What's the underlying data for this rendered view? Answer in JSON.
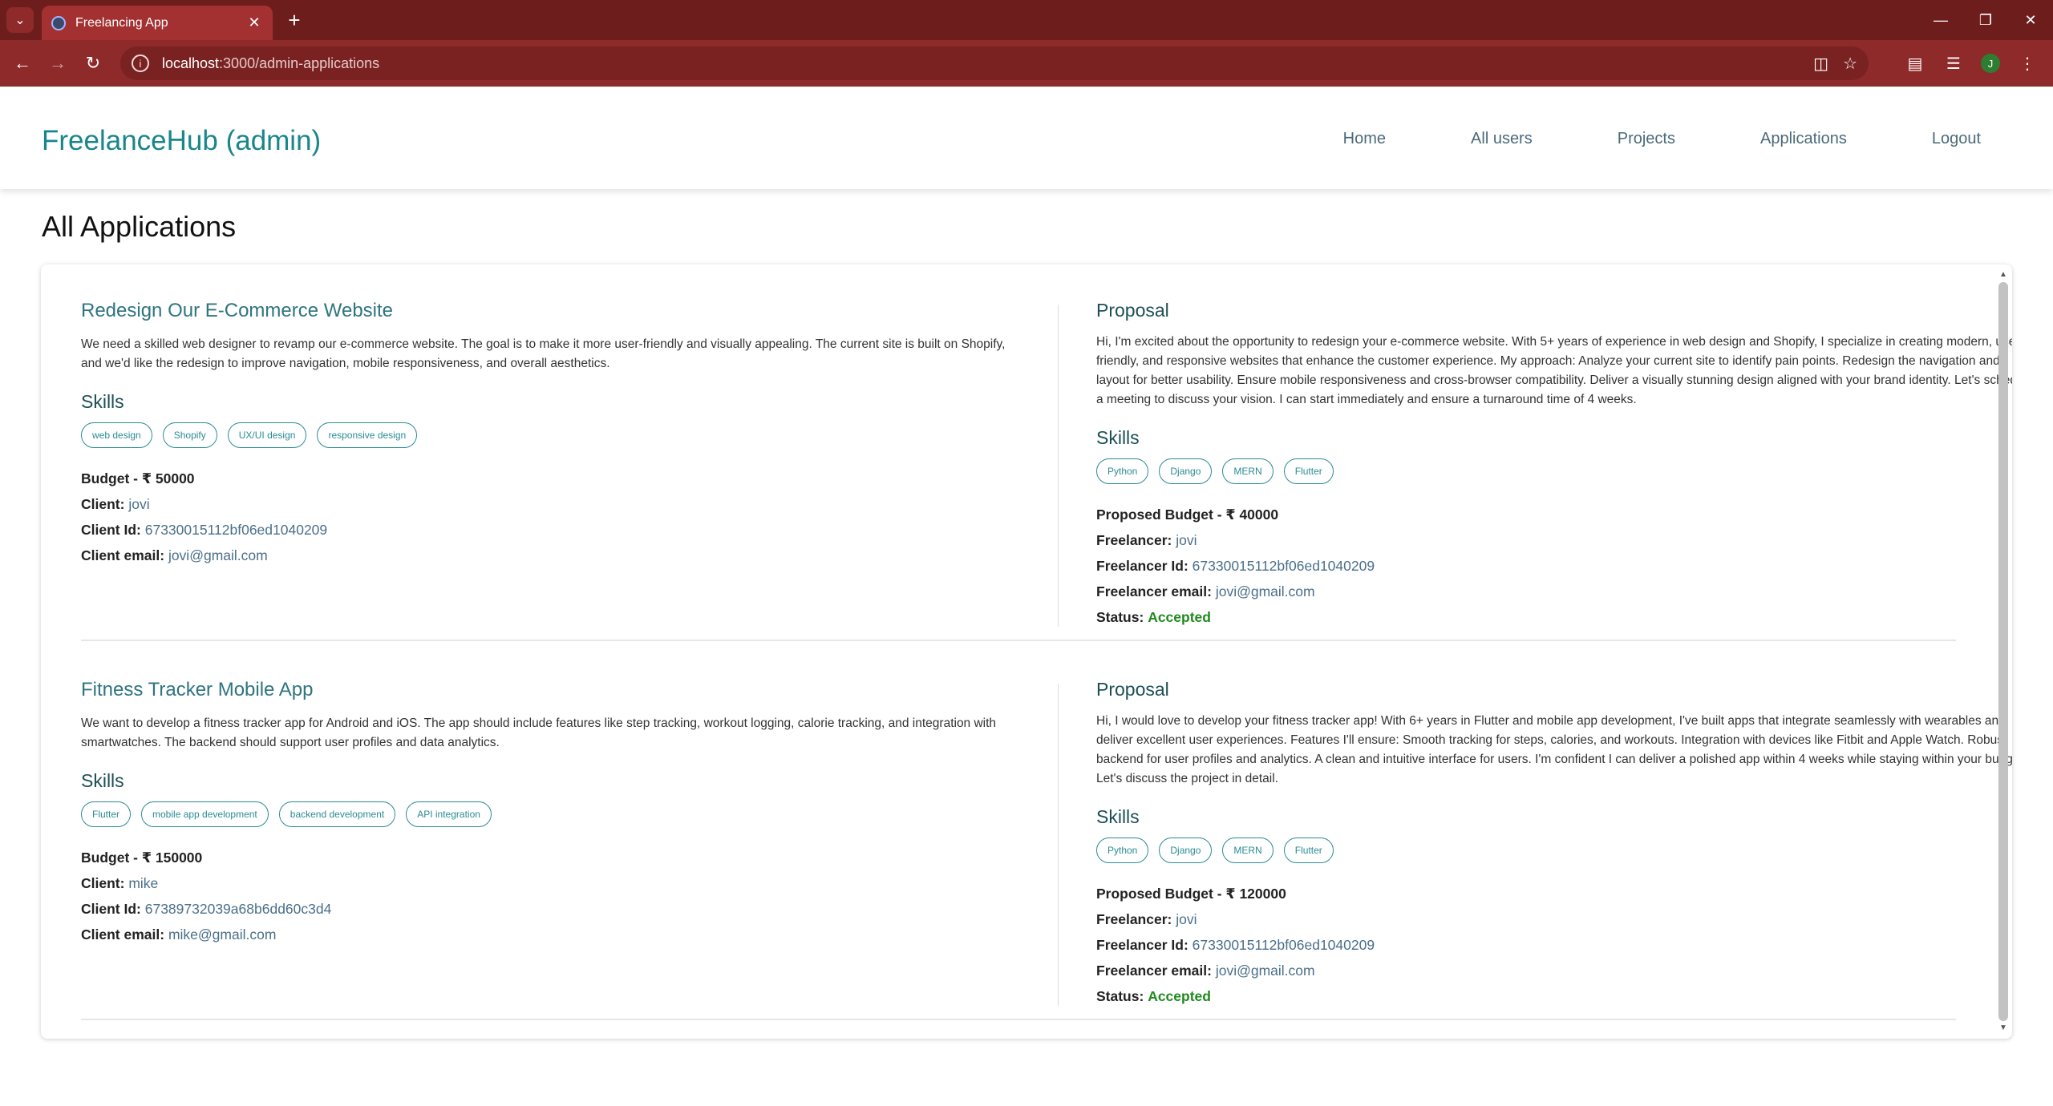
{
  "browser": {
    "tab_title": "Freelancing App",
    "url_host": "localhost",
    "url_path": ":3000/admin-applications",
    "profile_initial": "J"
  },
  "navbar": {
    "brand": "FreelanceHub (admin)",
    "links": [
      "Home",
      "All users",
      "Projects",
      "Applications",
      "Logout"
    ]
  },
  "page_title": "All Applications",
  "labels": {
    "skills": "Skills",
    "proposal": "Proposal",
    "budget": "Budget - ₹",
    "client": "Client:",
    "client_id": "Client Id:",
    "client_email": "Client email:",
    "proposed_budget": "Proposed Budget - ₹",
    "freelancer": "Freelancer:",
    "freelancer_id": "Freelancer Id:",
    "freelancer_email": "Freelancer email:",
    "status": "Status:"
  },
  "applications": [
    {
      "title": "Redesign Our E-Commerce Website",
      "description": "We need a skilled web designer to revamp our e-commerce website. The goal is to make it more user-friendly and visually appealing. The current site is built on Shopify, and we'd like the redesign to improve navigation, mobile responsiveness, and overall aesthetics.",
      "skills": [
        "web design",
        "Shopify",
        "UX/UI design",
        "responsive design"
      ],
      "budget": "50000",
      "client": "jovi",
      "client_id": "67330015112bf06ed1040209",
      "client_email": "jovi@gmail.com",
      "proposal": "Hi, I'm excited about the opportunity to redesign your e-commerce website. With 5+ years of experience in web design and Shopify, I specialize in creating modern, user-friendly, and responsive websites that enhance the customer experience. My approach: Analyze your current site to identify pain points. Redesign the navigation and layout for better usability. Ensure mobile responsiveness and cross-browser compatibility. Deliver a visually stunning design aligned with your brand identity. Let's schedule a meeting to discuss your vision. I can start immediately and ensure a turnaround time of 4 weeks.",
      "freelancer_skills": [
        "Python",
        "Django",
        "MERN",
        "Flutter"
      ],
      "proposed_budget": "40000",
      "freelancer": "jovi",
      "freelancer_id": "67330015112bf06ed1040209",
      "freelancer_email": "jovi@gmail.com",
      "status": "Accepted"
    },
    {
      "title": "Fitness Tracker Mobile App",
      "description": "We want to develop a fitness tracker app for Android and iOS. The app should include features like step tracking, workout logging, calorie tracking, and integration with smartwatches. The backend should support user profiles and data analytics.",
      "skills": [
        "Flutter",
        "mobile app development",
        "backend development",
        "API integration"
      ],
      "budget": "150000",
      "client": "mike",
      "client_id": "67389732039a68b6dd60c3d4",
      "client_email": "mike@gmail.com",
      "proposal": "Hi, I would love to develop your fitness tracker app! With 6+ years in Flutter and mobile app development, I've built apps that integrate seamlessly with wearables and deliver excellent user experiences. Features I'll ensure: Smooth tracking for steps, calories, and workouts. Integration with devices like Fitbit and Apple Watch. Robust backend for user profiles and analytics. A clean and intuitive interface for users. I'm confident I can deliver a polished app within 4 weeks while staying within your budget. Let's discuss the project in detail.",
      "freelancer_skills": [
        "Python",
        "Django",
        "MERN",
        "Flutter"
      ],
      "proposed_budget": "120000",
      "freelancer": "jovi",
      "freelancer_id": "67330015112bf06ed1040209",
      "freelancer_email": "jovi@gmail.com",
      "status": "Accepted"
    }
  ],
  "colors": {
    "chrome": "#6e1d1d",
    "brand": "#19868b",
    "accent": "#2b8c94",
    "accepted": "#1f8a1f"
  },
  "icons": {
    "tab_menu": "chevron-down-icon",
    "favicon": "react-icon",
    "close": "close-icon",
    "new_tab": "plus-icon",
    "back": "arrow-left-icon",
    "forward": "arrow-right-icon",
    "reload": "reload-icon",
    "site_info": "info-icon",
    "install": "install-icon",
    "bookmark": "star-icon",
    "extensions": "puzzle-icon",
    "media": "media-icon",
    "menu": "kebab-icon"
  }
}
